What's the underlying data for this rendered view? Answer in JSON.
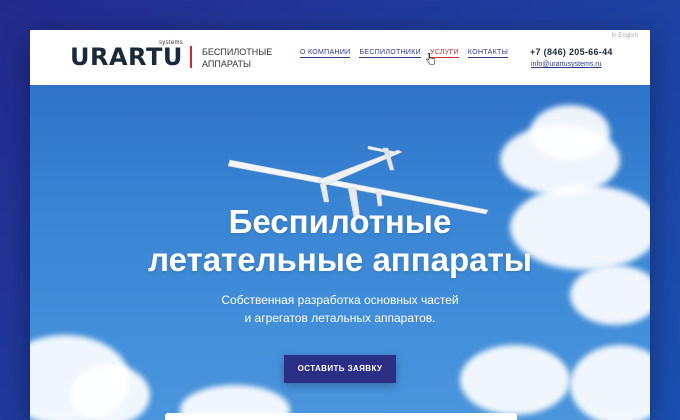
{
  "header": {
    "logo_small": "systems",
    "logo_text": "URARTU",
    "tagline_line1": "БЕСПИЛОТНЫЕ",
    "tagline_line2": "АППАРАТЫ",
    "language": "In English",
    "phone": "+7 (846) 205-66-44",
    "email": "info@urartusystems.ru",
    "accent": "#d8262e"
  },
  "nav": {
    "items": [
      "О КОМПАНИИ",
      "БЕСПИЛОТНИКИ",
      "УСЛУГИ",
      "КОНТАКТЫ"
    ],
    "active_item": "УСЛУГИ"
  },
  "hero": {
    "title_line1": "Беспилотные",
    "title_line2": "летательные аппараты",
    "subtitle_line1": "Собственная разработка основных частей",
    "subtitle_line2": "и агрегатов летальных аппаратов.",
    "cta_label": "ОСТАВИТЬ ЗАЯВКУ",
    "cta_color": "#2a2f85"
  },
  "icons": {
    "cursor": "hand-pointer-icon",
    "plane": "uav-plane-image"
  }
}
